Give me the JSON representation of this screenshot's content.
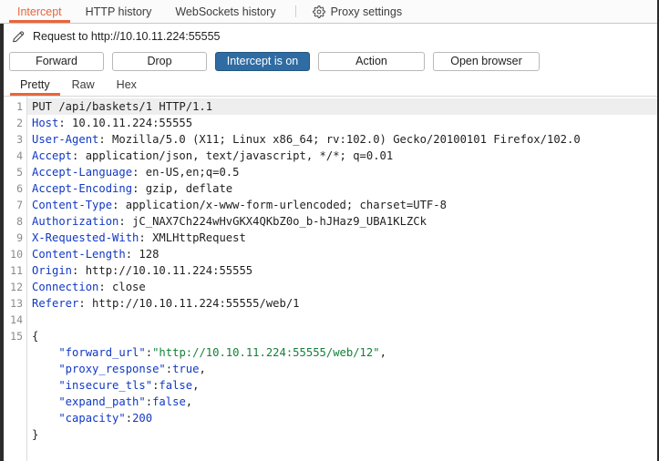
{
  "tabs": {
    "items": [
      {
        "label": "Intercept",
        "active": true
      },
      {
        "label": "HTTP history",
        "active": false
      },
      {
        "label": "WebSockets history",
        "active": false
      }
    ],
    "settings_label": "Proxy settings",
    "settings_icon": "gear-icon",
    "accent_color": "#e8663a"
  },
  "request_bar": {
    "icon": "pencil-icon",
    "title": "Request to http://10.10.11.224:55555"
  },
  "actions": {
    "forward": "Forward",
    "drop": "Drop",
    "intercept_toggle": "Intercept is on",
    "intercept_on": true,
    "action": "Action",
    "open_browser": "Open browser",
    "primary_color": "#2f6ca3"
  },
  "view_tabs": {
    "items": [
      {
        "label": "Pretty",
        "active": true
      },
      {
        "label": "Raw",
        "active": false
      },
      {
        "label": "Hex",
        "active": false
      }
    ]
  },
  "editor": {
    "line_numbers": [
      1,
      2,
      3,
      4,
      5,
      6,
      7,
      8,
      9,
      10,
      11,
      12,
      13,
      14,
      15
    ],
    "lines": [
      {
        "n": 1,
        "highlight": true,
        "segments": [
          {
            "t": "PUT /api/baskets/1 HTTP/1.1",
            "c": "pl"
          }
        ]
      },
      {
        "n": 2,
        "highlight": false,
        "segments": [
          {
            "t": "Host",
            "c": "hk"
          },
          {
            "t": ": 10.10.11.224:55555",
            "c": "pl"
          }
        ]
      },
      {
        "n": 3,
        "highlight": false,
        "segments": [
          {
            "t": "User-Agent",
            "c": "hk"
          },
          {
            "t": ": Mozilla/5.0 (X11; Linux x86_64; rv:102.0) Gecko/20100101 Firefox/102.0",
            "c": "pl"
          }
        ]
      },
      {
        "n": 4,
        "highlight": false,
        "segments": [
          {
            "t": "Accept",
            "c": "hk"
          },
          {
            "t": ": application/json, text/javascript, */*; q=0.01",
            "c": "pl"
          }
        ]
      },
      {
        "n": 5,
        "highlight": false,
        "segments": [
          {
            "t": "Accept-Language",
            "c": "hk"
          },
          {
            "t": ": en-US,en;q=0.5",
            "c": "pl"
          }
        ]
      },
      {
        "n": 6,
        "highlight": false,
        "segments": [
          {
            "t": "Accept-Encoding",
            "c": "hk"
          },
          {
            "t": ": gzip, deflate",
            "c": "pl"
          }
        ]
      },
      {
        "n": 7,
        "highlight": false,
        "segments": [
          {
            "t": "Content-Type",
            "c": "hk"
          },
          {
            "t": ": application/x-www-form-urlencoded; charset=UTF-8",
            "c": "pl"
          }
        ]
      },
      {
        "n": 8,
        "highlight": false,
        "segments": [
          {
            "t": "Authorization",
            "c": "hk"
          },
          {
            "t": ": jC_NAX7Ch224wHvGKX4QKbZ0o_b-hJHaz9_UBA1KLZCk",
            "c": "pl"
          }
        ]
      },
      {
        "n": 9,
        "highlight": false,
        "segments": [
          {
            "t": "X-Requested-With",
            "c": "hk"
          },
          {
            "t": ": XMLHttpRequest",
            "c": "pl"
          }
        ]
      },
      {
        "n": 10,
        "highlight": false,
        "segments": [
          {
            "t": "Content-Length",
            "c": "hk"
          },
          {
            "t": ": 128",
            "c": "pl"
          }
        ]
      },
      {
        "n": 11,
        "highlight": false,
        "segments": [
          {
            "t": "Origin",
            "c": "hk"
          },
          {
            "t": ": http://10.10.11.224:55555",
            "c": "pl"
          }
        ]
      },
      {
        "n": 12,
        "highlight": false,
        "segments": [
          {
            "t": "Connection",
            "c": "hk"
          },
          {
            "t": ": close",
            "c": "pl"
          }
        ]
      },
      {
        "n": 13,
        "highlight": false,
        "segments": [
          {
            "t": "Referer",
            "c": "hk"
          },
          {
            "t": ": http://10.10.11.224:55555/web/1",
            "c": "pl"
          }
        ]
      },
      {
        "n": 14,
        "highlight": false,
        "segments": [
          {
            "t": "",
            "c": "pl"
          }
        ]
      },
      {
        "n": 15,
        "highlight": false,
        "segments": [
          {
            "t": "{",
            "c": "pl"
          }
        ]
      },
      {
        "n": null,
        "highlight": false,
        "segments": [
          {
            "t": "    \"forward_url\"",
            "c": "jk"
          },
          {
            "t": ":",
            "c": "pl"
          },
          {
            "t": "\"http://10.10.11.224:55555/web/12\"",
            "c": "js"
          },
          {
            "t": ",",
            "c": "pl"
          }
        ]
      },
      {
        "n": null,
        "highlight": false,
        "segments": [
          {
            "t": "    \"proxy_response\"",
            "c": "jk"
          },
          {
            "t": ":",
            "c": "pl"
          },
          {
            "t": "true",
            "c": "jb"
          },
          {
            "t": ",",
            "c": "pl"
          }
        ]
      },
      {
        "n": null,
        "highlight": false,
        "segments": [
          {
            "t": "    \"insecure_tls\"",
            "c": "jk"
          },
          {
            "t": ":",
            "c": "pl"
          },
          {
            "t": "false",
            "c": "jb"
          },
          {
            "t": ",",
            "c": "pl"
          }
        ]
      },
      {
        "n": null,
        "highlight": false,
        "segments": [
          {
            "t": "    \"expand_path\"",
            "c": "jk"
          },
          {
            "t": ":",
            "c": "pl"
          },
          {
            "t": "false",
            "c": "jb"
          },
          {
            "t": ",",
            "c": "pl"
          }
        ]
      },
      {
        "n": null,
        "highlight": false,
        "segments": [
          {
            "t": "    \"capacity\"",
            "c": "jk"
          },
          {
            "t": ":",
            "c": "pl"
          },
          {
            "t": "200",
            "c": "jb"
          }
        ]
      },
      {
        "n": null,
        "highlight": false,
        "segments": [
          {
            "t": "}",
            "c": "pl"
          }
        ]
      }
    ]
  }
}
